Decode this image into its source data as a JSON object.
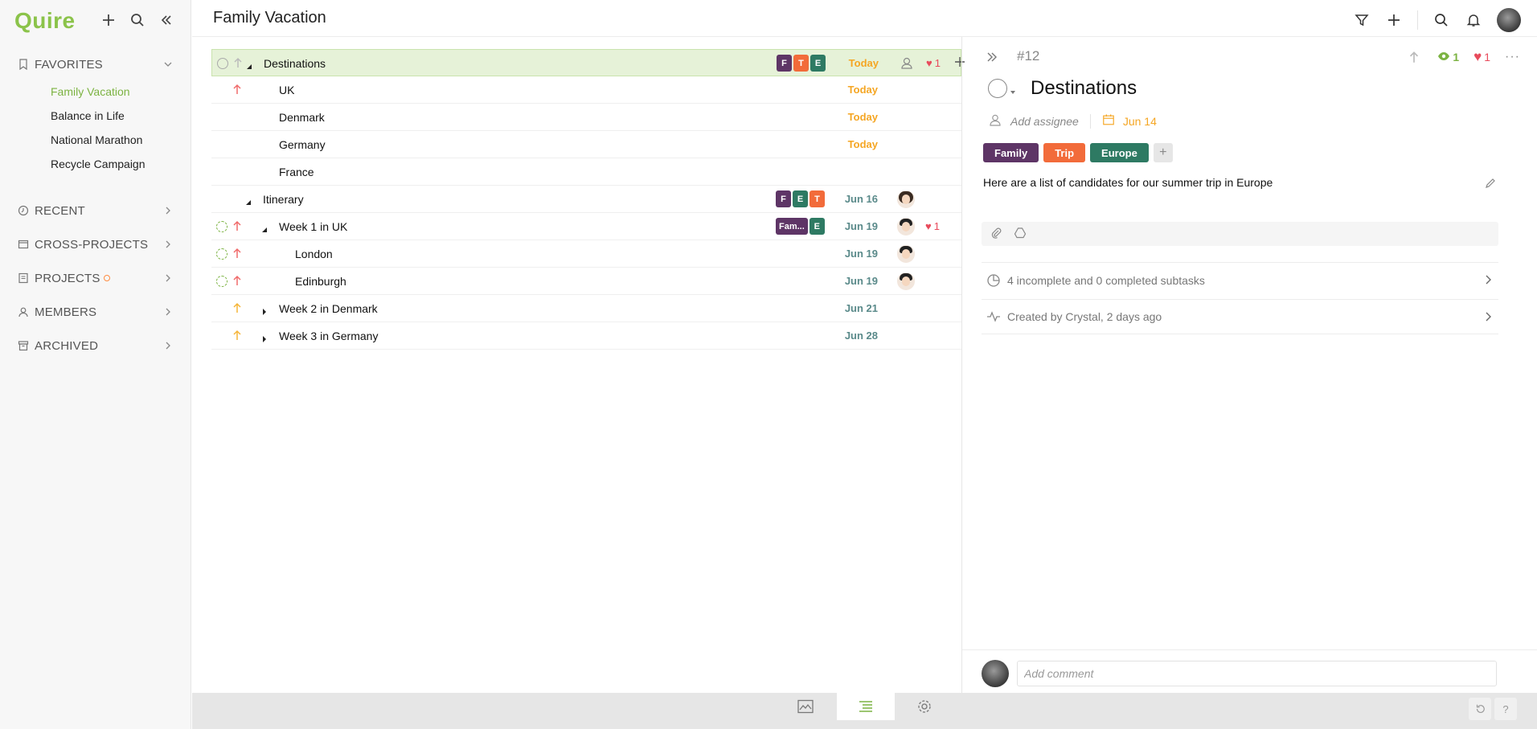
{
  "app": {
    "brand": "Quire"
  },
  "sidebar": {
    "favorites_label": "FAVORITES",
    "favorites": [
      {
        "label": "Family Vacation",
        "active": true
      },
      {
        "label": "Balance in Life"
      },
      {
        "label": "National Marathon"
      },
      {
        "label": "Recycle Campaign"
      }
    ],
    "sections": [
      {
        "label": "RECENT",
        "icon": "clock-icon"
      },
      {
        "label": "CROSS-PROJECTS",
        "icon": "folder-icon"
      },
      {
        "label": "PROJECTS",
        "icon": "projects-icon",
        "badge": true
      },
      {
        "label": "MEMBERS",
        "icon": "members-icon"
      },
      {
        "label": "ARCHIVED",
        "icon": "archive-icon"
      }
    ]
  },
  "header": {
    "title": "Family Vacation"
  },
  "colors": {
    "accent": "#8bc34a",
    "tag_family": "#5e3566",
    "tag_trip": "#f26b3a",
    "tag_europe": "#2e7a63",
    "date_today": "#f5a623",
    "date_future": "#5a8a8a",
    "priority_high": "#f06b6b",
    "priority_medium": "#f5b53a"
  },
  "tasks": [
    {
      "name": "Destinations",
      "date": "Today",
      "likes": "1",
      "tags": [
        "F",
        "T",
        "E"
      ]
    },
    {
      "name": "UK",
      "date": "Today"
    },
    {
      "name": "Denmark",
      "date": "Today"
    },
    {
      "name": "Germany",
      "date": "Today"
    },
    {
      "name": "France",
      "date": ""
    },
    {
      "name": "Itinerary",
      "date": "Jun 16",
      "tags": [
        "F",
        "E",
        "T"
      ]
    },
    {
      "name": "Week 1 in UK",
      "date": "Jun 19",
      "likes": "1",
      "tags": [
        "Fam...",
        "E"
      ]
    },
    {
      "name": "London",
      "date": "Jun 19"
    },
    {
      "name": "Edinburgh",
      "date": "Jun 19"
    },
    {
      "name": "Week 2 in Denmark",
      "date": "Jun 21"
    },
    {
      "name": "Week 3 in Germany",
      "date": "Jun 28"
    }
  ],
  "detail": {
    "id": "#12",
    "views": "1",
    "likes": "1",
    "title": "Destinations",
    "assignee_placeholder": "Add assignee",
    "due": "Jun 14",
    "tags": [
      "Family",
      "Trip",
      "Europe"
    ],
    "description": "Here are a list of candidates for our summer trip in Europe",
    "subtasks": "4 incomplete and 0 completed subtasks",
    "activity": "Created by Crystal, 2 days ago",
    "comment_placeholder": "Add comment"
  },
  "bottom": {
    "help": "?"
  }
}
